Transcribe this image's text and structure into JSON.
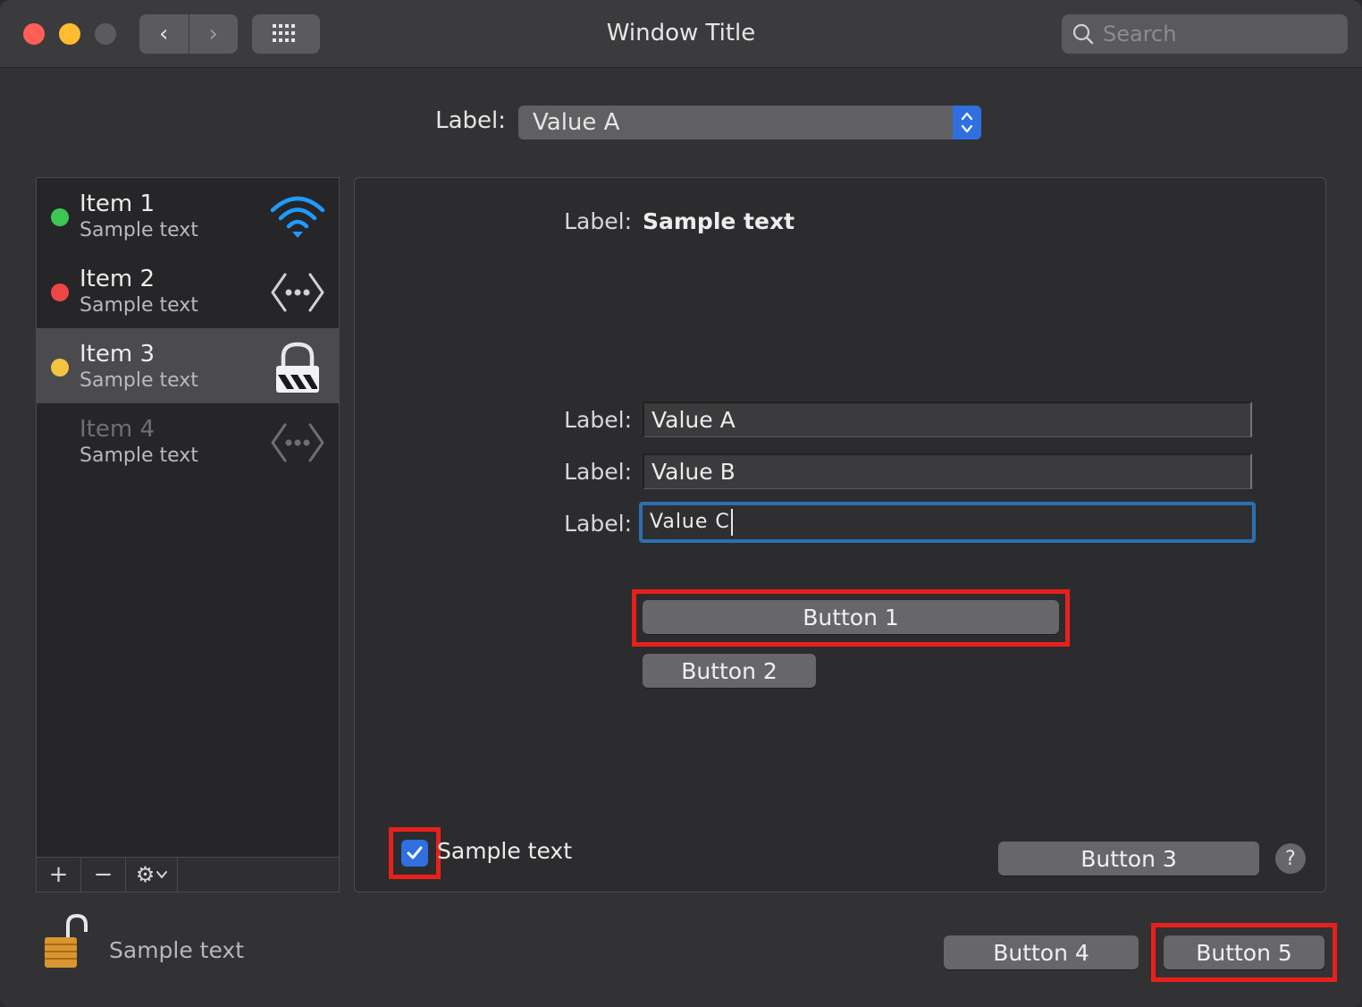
{
  "window": {
    "title": "Window Title"
  },
  "toolbar": {
    "back_glyph": "‹",
    "forward_glyph": "›",
    "grid_icon": "grid-icon",
    "search_placeholder": "Search"
  },
  "location": {
    "label": "Label:",
    "value": "Value A"
  },
  "services": [
    {
      "name": "Item 1",
      "state": "Sample text",
      "status_color": "#3dc752",
      "icon": "wifi-icon"
    },
    {
      "name": "Item 2",
      "state": "Sample text",
      "status_color": "#ee4646",
      "icon": "ethernet-icon"
    },
    {
      "name": "Item 3",
      "state": "Sample text",
      "status_color": "#f4c440",
      "icon": "lock-icon",
      "selected": true
    },
    {
      "name": "Item 4",
      "state": "Sample text",
      "status_color": "",
      "icon": "ethernet-icon",
      "disabled": true
    }
  ],
  "sidebar_toolbar": {
    "add": "+",
    "remove": "−",
    "gear": "⚙"
  },
  "details": {
    "status_label": "Label:",
    "status_value": "Sample text",
    "server_label": "Label:",
    "server_value": "Value A",
    "account_label": "Label:",
    "account_value": "Value B",
    "password_label": "Label:",
    "password_value": "Value C",
    "auth_button": "Button 1",
    "connect_button": "Button 2",
    "show_status_label": "Sample text",
    "show_status_checked": true,
    "advanced_button": "Button 3",
    "help": "?"
  },
  "footer": {
    "lock_text": "Sample text",
    "revert_button": "Button 4",
    "apply_button": "Button 5"
  },
  "colors": {
    "accent": "#2f6fe0",
    "highlight": "#e8201c",
    "status_green": "#3dc752",
    "status_red": "#ee4646",
    "status_yellow": "#f4c440",
    "wifi_blue": "#1e9bff"
  }
}
